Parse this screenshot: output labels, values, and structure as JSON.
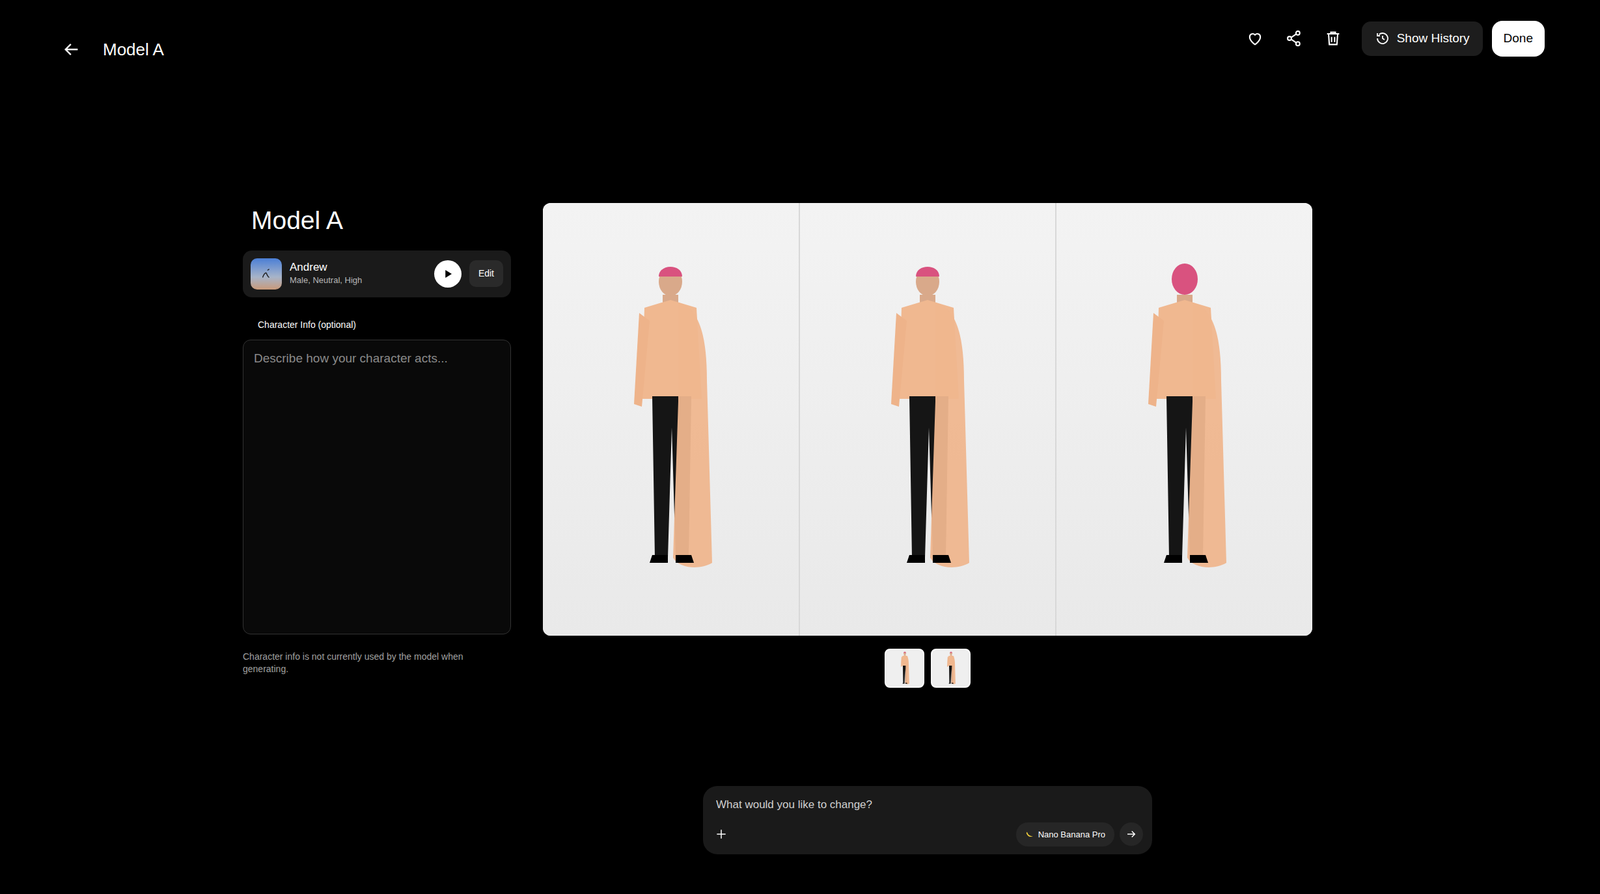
{
  "header": {
    "title": "Model A",
    "show_history": "Show History",
    "done": "Done"
  },
  "panel": {
    "title": "Model A",
    "voice": {
      "name": "Andrew",
      "traits": "Male, Neutral, High",
      "edit": "Edit"
    },
    "character_info": {
      "label": "Character Info (optional)",
      "placeholder": "Describe how your character acts...",
      "note": "Character info is not currently used by the model when generating."
    }
  },
  "prompt": {
    "placeholder": "What would you like to change?",
    "model": "Nano Banana Pro"
  }
}
